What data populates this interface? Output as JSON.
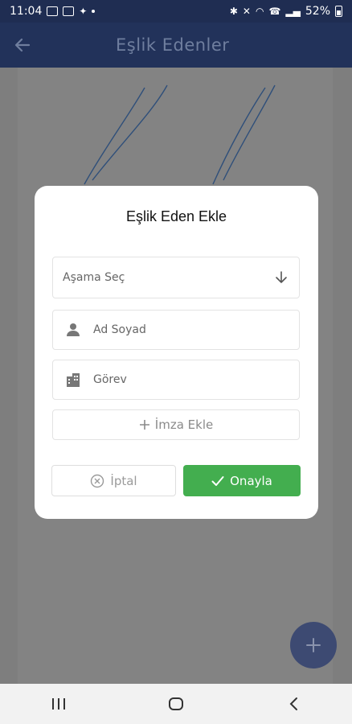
{
  "status_bar": {
    "time": "11:04",
    "battery": "52%"
  },
  "app_bar": {
    "title": "Eşlik Edenler"
  },
  "dialog": {
    "title": "Eşlik Eden Ekle",
    "stage_select": {
      "value": "Aşama Seç"
    },
    "name_field": {
      "placeholder": "Ad Soyad"
    },
    "role_field": {
      "placeholder": "Görev"
    },
    "add_signature_label": "İmza Ekle",
    "cancel_label": "İptal",
    "confirm_label": "Onayla"
  },
  "colors": {
    "app_bar": "#22325a",
    "confirm": "#43ae4f",
    "fab": "#3d4a72"
  },
  "icons": [
    "back-arrow-icon",
    "arrow-down-icon",
    "person-icon",
    "building-icon",
    "plus-icon",
    "cancel-circle-icon",
    "check-icon",
    "recent-apps-icon",
    "home-icon",
    "nav-back-icon"
  ]
}
